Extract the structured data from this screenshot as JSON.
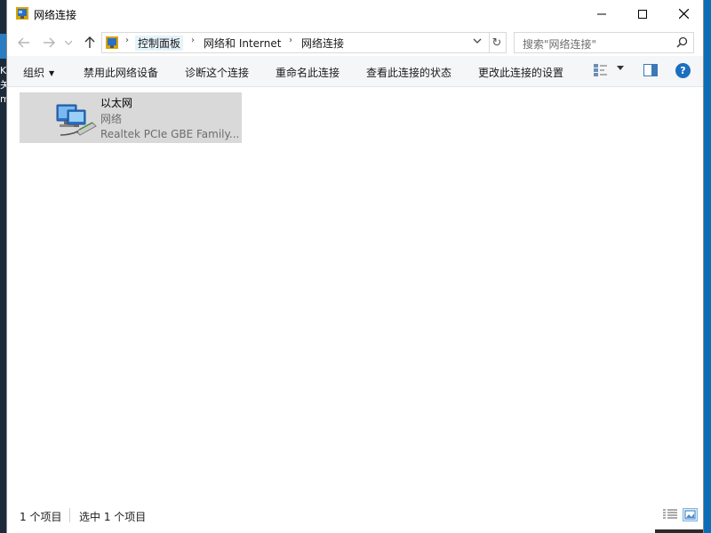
{
  "window": {
    "title": "网络连接"
  },
  "desktop": {
    "fragments": [
      "K",
      "关",
      "m"
    ]
  },
  "caption_buttons": {
    "minimize": "─",
    "maximize": "☐",
    "close": "✕"
  },
  "address_bar": {
    "crumbs": [
      "控制面板",
      "网络和 Internet",
      "网络连接"
    ],
    "separator": "›",
    "dropdown_glyph": "⌄",
    "refresh_glyph": "↻"
  },
  "search": {
    "placeholder": "搜索\"网络连接\""
  },
  "commands": {
    "organize": "组织",
    "disable": "禁用此网络设备",
    "diagnose": "诊断这个连接",
    "rename": "重命名此连接",
    "status": "查看此连接的状态",
    "settings": "更改此连接的设置",
    "help": "?"
  },
  "items": [
    {
      "name": "以太网",
      "type": "网络",
      "device": "Realtek PCIe GBE Family..."
    }
  ],
  "status_bar": {
    "count": "1 个项目",
    "selected": "选中 1 个项目"
  },
  "icons": {
    "window": "network-connections-icon",
    "item": "ethernet-adapter-icon",
    "search": "search-icon"
  },
  "colors": {
    "accent": "#1a6fc0",
    "selection": "#d9d9d9",
    "crumb_highlight": "#e5f3fb"
  }
}
